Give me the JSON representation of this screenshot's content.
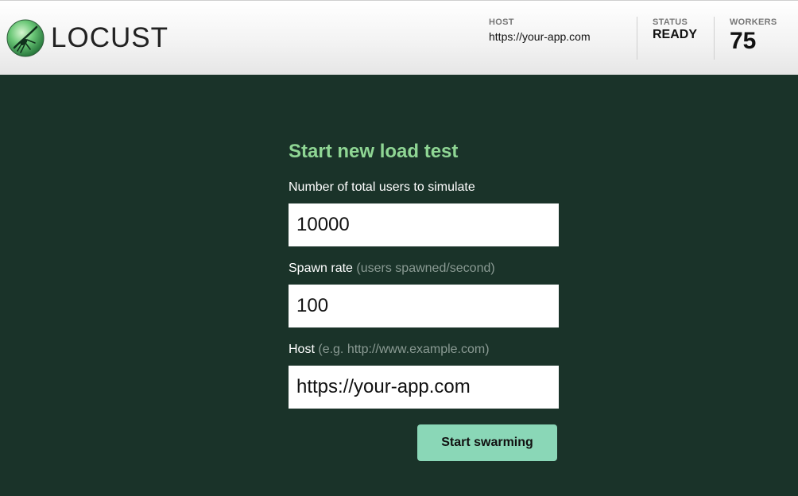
{
  "header": {
    "logo_text": "LOCUST",
    "stats": {
      "host": {
        "label": "HOST",
        "value": "https://your-app.com"
      },
      "status": {
        "label": "STATUS",
        "value": "READY"
      },
      "workers": {
        "label": "WORKERS",
        "value": "75"
      }
    }
  },
  "form": {
    "title": "Start new load test",
    "users": {
      "label": "Number of total users to simulate",
      "hint": "",
      "value": "10000"
    },
    "spawn_rate": {
      "label": "Spawn rate",
      "hint": "(users spawned/second)",
      "value": "100"
    },
    "host": {
      "label": "Host",
      "hint": "(e.g. http://www.example.com)",
      "value": "https://your-app.com"
    },
    "submit_label": "Start swarming"
  },
  "colors": {
    "background": "#1a3329",
    "title": "#8fd694",
    "button": "#8ad7b7"
  }
}
